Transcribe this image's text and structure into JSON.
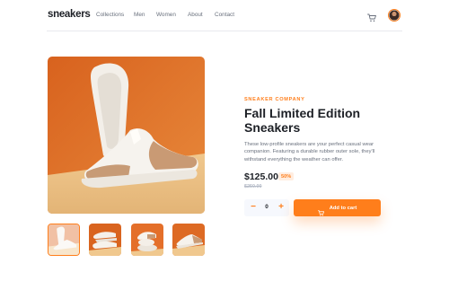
{
  "header": {
    "logo": "sneakers",
    "nav": [
      "Collections",
      "Men",
      "Women",
      "About",
      "Contact"
    ]
  },
  "icons": {
    "cart": "cart-icon",
    "avatar": "avatar",
    "minus": "minus-icon",
    "plus": "plus-icon",
    "add_cart": "cart-icon"
  },
  "product": {
    "company": "Sneaker Company",
    "title": "Fall Limited Edition Sneakers",
    "description": "These low-profile sneakers are your perfect casual wear companion. Featuring a durable rubber outer sole, they'll withstand everything the weather can offer.",
    "price": "$125.00",
    "discount": "50%",
    "old_price": "$250.00"
  },
  "cart_controls": {
    "quantity": "0",
    "minus_label": "−",
    "plus_label": "+",
    "add_label": "Add to cart"
  },
  "gallery": {
    "selected_thumbnail": 1,
    "thumbnail_count": 4
  },
  "colors": {
    "accent": "#ff7e1b",
    "accent_pale": "#ffede0",
    "text_dark": "#1d2026",
    "text_muted": "#69707d"
  }
}
